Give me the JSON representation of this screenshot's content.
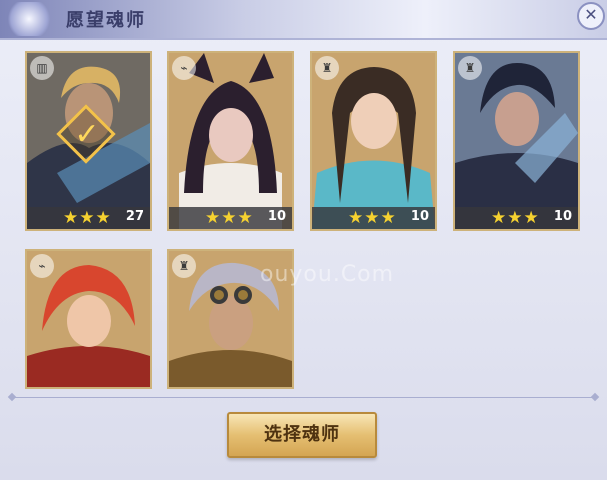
{
  "header": {
    "title": "愿望魂师",
    "close_label": "✕"
  },
  "cards": [
    {
      "name": "card-1",
      "class_icon": "ranged-icon",
      "class_glyph": "▥",
      "level": "27",
      "stars": "★★★",
      "selected": true
    },
    {
      "name": "card-2",
      "class_icon": "bird-icon",
      "class_glyph": "⌁",
      "level": "10",
      "stars": "★★★",
      "selected": false
    },
    {
      "name": "card-3",
      "class_icon": "tower-icon",
      "class_glyph": "♜",
      "level": "10",
      "stars": "★★★",
      "selected": false
    },
    {
      "name": "card-4",
      "class_icon": "tower-icon",
      "class_glyph": "♜",
      "level": "10",
      "stars": "★★★",
      "selected": false
    },
    {
      "name": "card-5",
      "class_icon": "bird-icon",
      "class_glyph": "⌁",
      "level": "",
      "stars": "",
      "selected": false
    },
    {
      "name": "card-6",
      "class_icon": "tower-icon",
      "class_glyph": "♜",
      "level": "",
      "stars": "",
      "selected": false
    }
  ],
  "select_button_label": "选择魂师",
  "watermark_text": "ouyou.Com",
  "colors": {
    "accent_gold": "#d4a553",
    "star": "#f5d130",
    "header": "#7e85b8"
  }
}
